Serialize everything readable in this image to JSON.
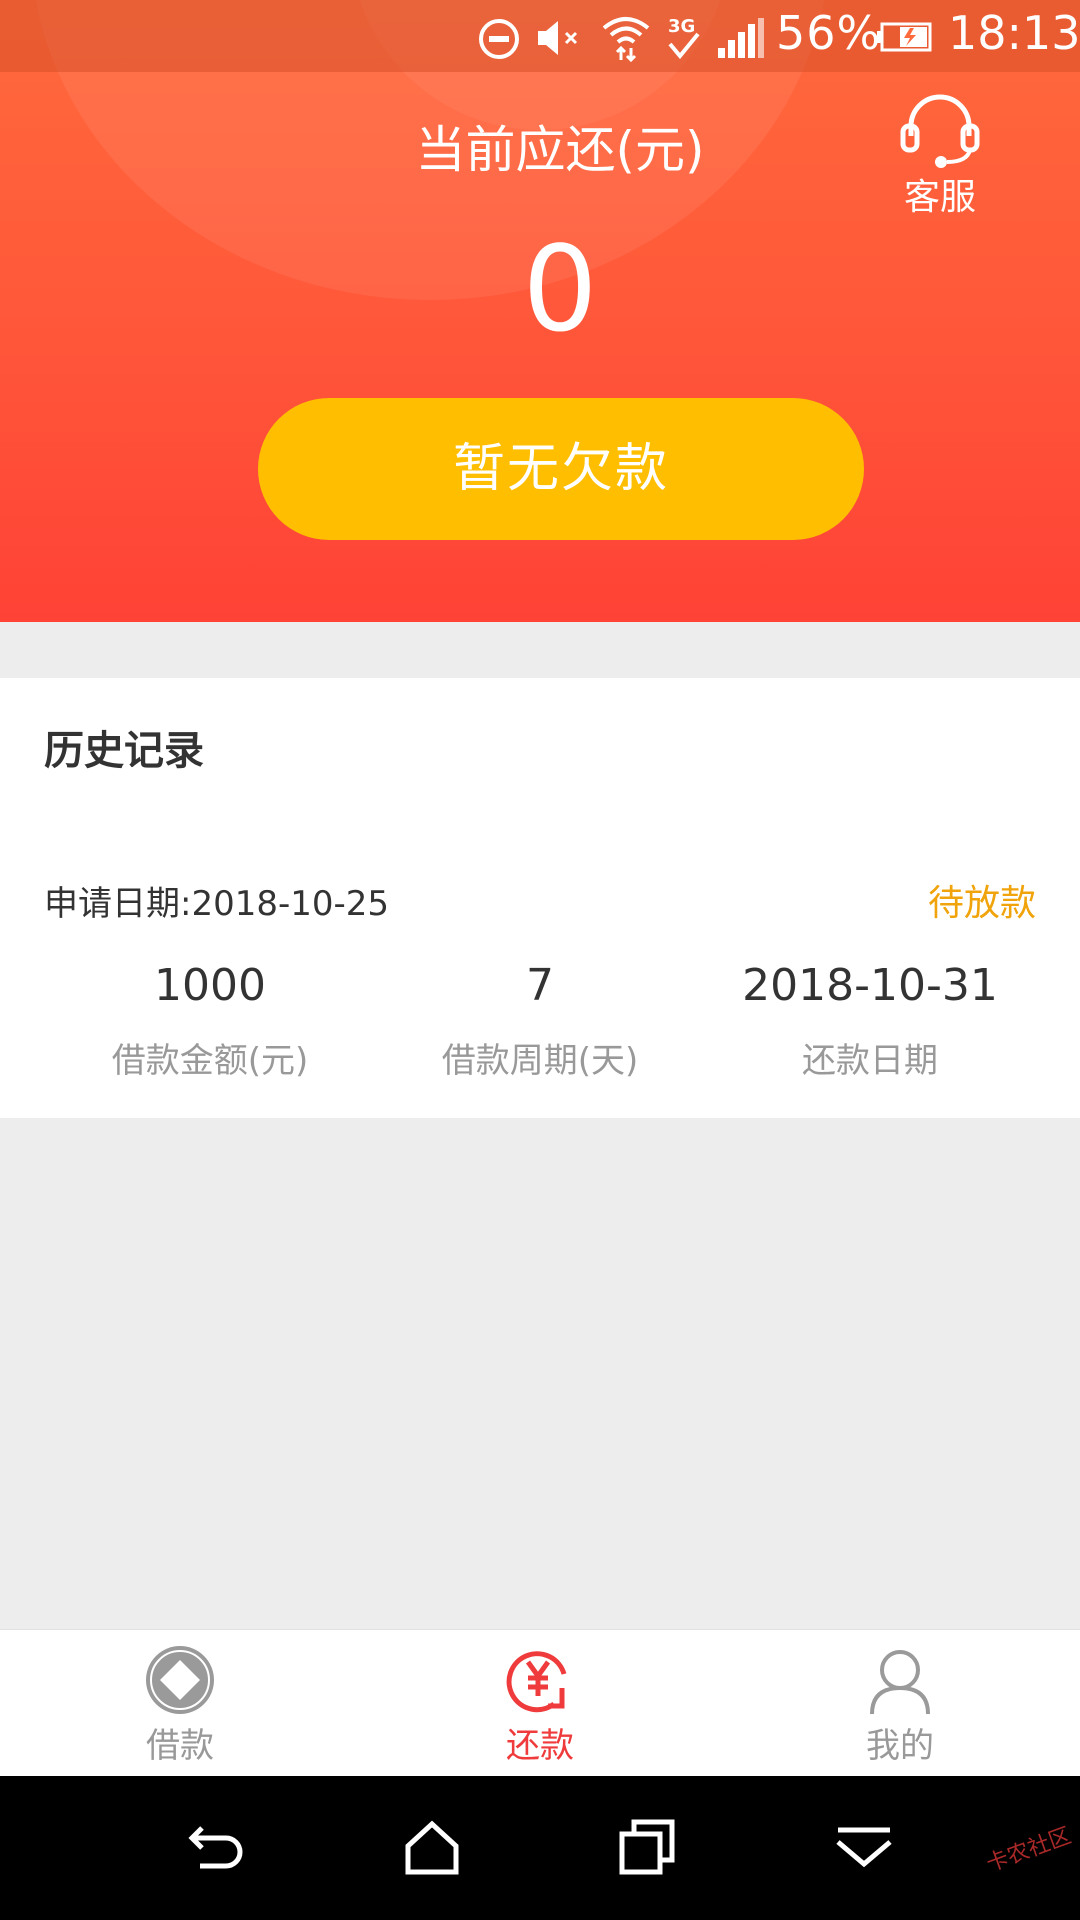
{
  "status_bar": {
    "battery_percent": "56%",
    "time": "18:13",
    "icons": [
      "do-not-disturb-icon",
      "mute-icon",
      "wifi-icon",
      "3g-signal-icon",
      "cell-signal-icon",
      "battery-charging-icon"
    ]
  },
  "header": {
    "title": "当前应还(元)",
    "amount": "0",
    "customer_service_label": "客服",
    "action_button_label": "暂无欠款"
  },
  "history": {
    "title": "历史记录",
    "records": [
      {
        "apply_date": "申请日期:2018-10-25",
        "status": "待放款",
        "stats": [
          {
            "value": "1000",
            "label": "借款金额(元)"
          },
          {
            "value": "7",
            "label": "借款周期(天)"
          },
          {
            "value": "2018-10-31",
            "label": "还款日期"
          }
        ]
      }
    ]
  },
  "tabbar": {
    "tabs": [
      {
        "label": "借款",
        "icon": "loan-diamond-icon",
        "active": false
      },
      {
        "label": "还款",
        "icon": "repay-yen-icon",
        "active": true
      },
      {
        "label": "我的",
        "icon": "profile-icon",
        "active": false
      }
    ]
  },
  "watermark": "卡农社区",
  "colors": {
    "header_top": "#ff6a3c",
    "header_bottom": "#ff4236",
    "button_yellow": "#ffbf00",
    "status_orange": "#f0a30a",
    "active_red": "#ef3b3b"
  }
}
